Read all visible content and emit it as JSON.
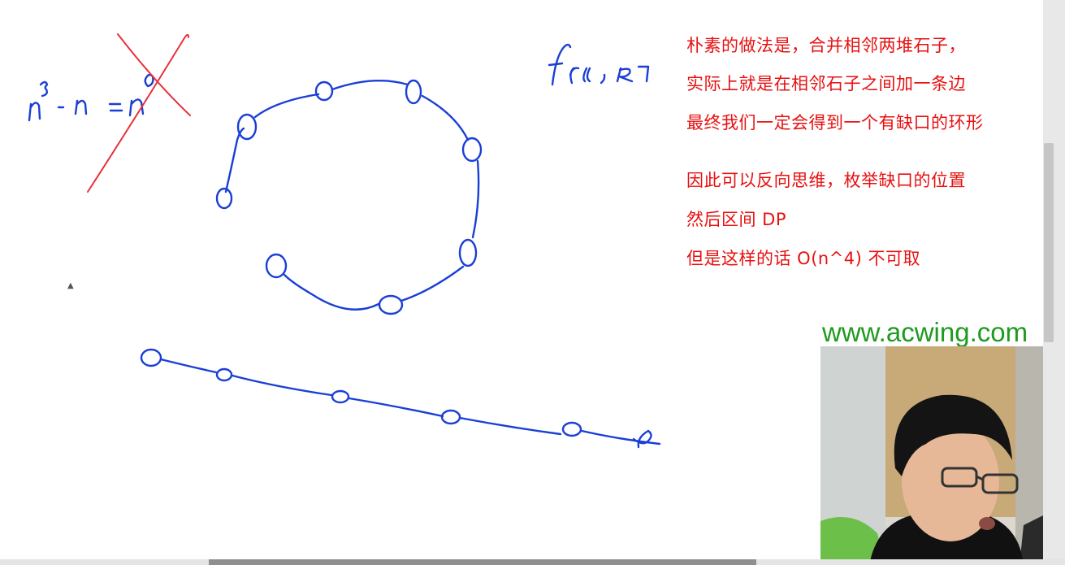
{
  "notes": {
    "line1": "朴素的做法是，合并相邻两堆石子，",
    "line2": "实际上就是在相邻石子之间加一条边",
    "line3": "最终我们一定会得到一个有缺口的环形",
    "line4": "因此可以反向思维，枚举缺口的位置",
    "line5": "然后区间 DP",
    "line6": "但是这样的话 O(n^4) 不可取"
  },
  "watermark": {
    "text": "www.acwing.com"
  },
  "handwriting": {
    "formula": "n³ - n = n⁰",
    "function": "f[L, R]"
  },
  "colors": {
    "ink": "#1a3fd6",
    "cross": "#e8323c",
    "note_text": "#e81010",
    "watermark": "#1e9a1e"
  },
  "icons": {
    "cursor": "pen-cursor-icon"
  }
}
